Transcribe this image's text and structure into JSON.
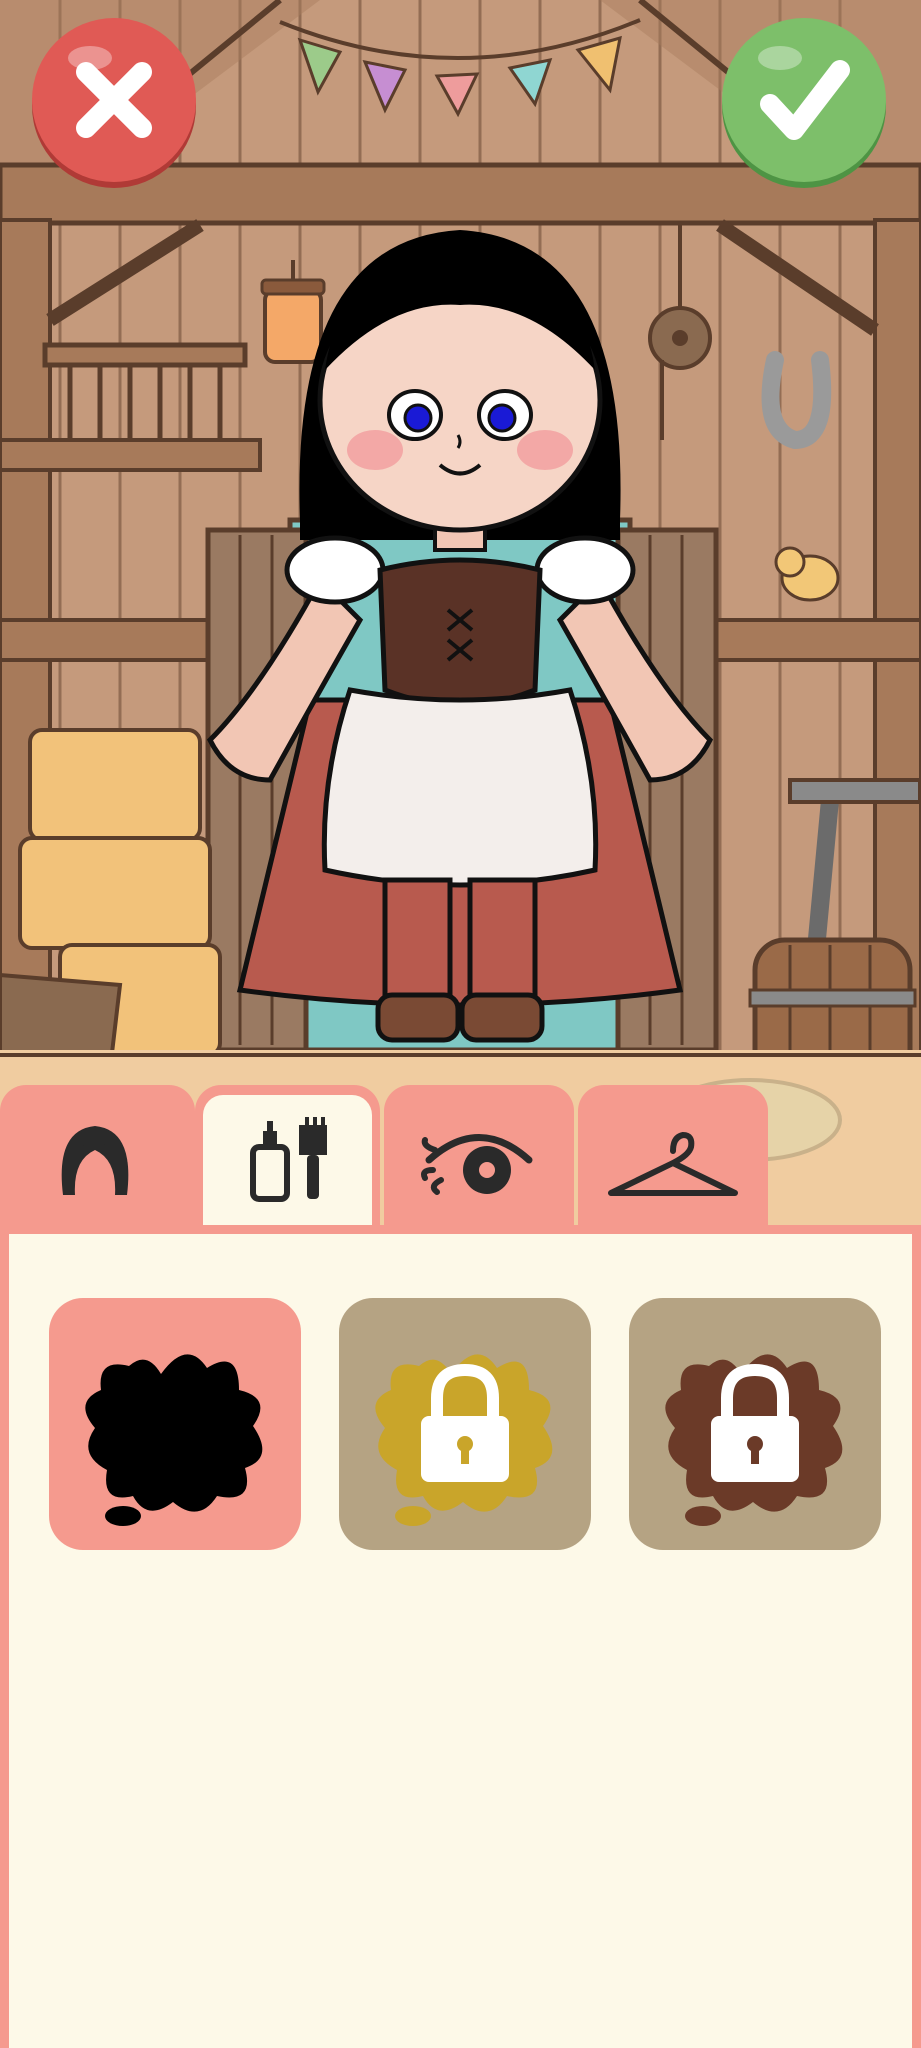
{
  "game": {
    "screen": "dress-up-customizer",
    "scene": "barn"
  },
  "toolbar": {
    "cancel_icon": "x-icon",
    "confirm_icon": "check-icon"
  },
  "tabs": [
    {
      "id": "hair",
      "icon": "hair-icon",
      "selected": false
    },
    {
      "id": "color",
      "icon": "dye-brush-icon",
      "selected": true
    },
    {
      "id": "face",
      "icon": "eye-lash-icon",
      "selected": false
    },
    {
      "id": "clothes",
      "icon": "hanger-icon",
      "selected": false
    }
  ],
  "swatches": [
    {
      "color": "#000000",
      "locked": false,
      "selected": true
    },
    {
      "color": "#C9A52A",
      "locked": true,
      "selected": false
    },
    {
      "color": "#6B3A28",
      "locked": true,
      "selected": false
    }
  ],
  "colors": {
    "panel_bg": "#FDF9E8",
    "panel_border": "#F59A8E",
    "tab_inactive": "#F59A8E",
    "tab_active": "#FDF9E8",
    "swatch_selected_bg": "#F59A8E",
    "swatch_locked_bg": "#B5A383",
    "cancel_red": "#E05A55",
    "confirm_green": "#7DBF6A"
  }
}
